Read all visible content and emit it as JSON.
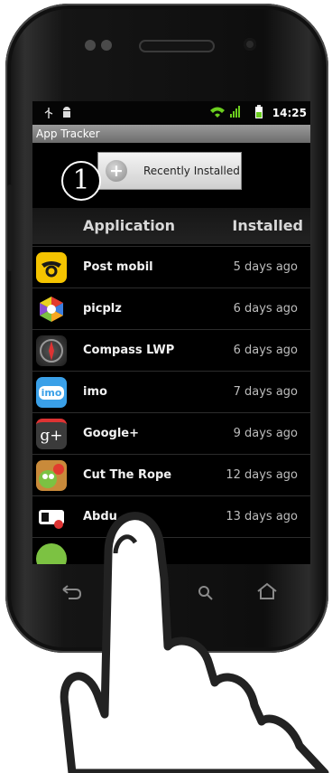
{
  "status": {
    "time": "14:25"
  },
  "app": {
    "title": "App Tracker"
  },
  "toolbar": {
    "filter_label": "Recently Installed",
    "step_number": "1"
  },
  "columns": {
    "application": "Application",
    "installed": "Installed"
  },
  "apps": [
    {
      "name": "Post mobil",
      "installed": "5 days ago",
      "icon": "post-horn-icon",
      "color": "#f5c400"
    },
    {
      "name": "picplz",
      "installed": "6 days ago",
      "icon": "picplz-icon",
      "color": "#3b7de0"
    },
    {
      "name": "Compass LWP",
      "installed": "6 days ago",
      "icon": "compass-icon",
      "color": "#3a3a3a"
    },
    {
      "name": "imo",
      "installed": "7 days ago",
      "icon": "imo-icon",
      "icon_text": "imo",
      "color": "#3aa0e8"
    },
    {
      "name": "Google+",
      "installed": "9 days ago",
      "icon": "google-plus-icon",
      "icon_text": "g+",
      "color": "#3b3b3b"
    },
    {
      "name": "Cut The Rope",
      "installed": "12 days ago",
      "icon": "cut-the-rope-icon",
      "color": "#c98a3a"
    },
    {
      "name": "Abdu",
      "installed": "13 days ago",
      "icon": "abdu-icon",
      "color": "#ffffff"
    }
  ],
  "colors": {
    "title_bar": "#8a8a8a",
    "list_bg": "#000000",
    "accent_green": "#6ccf1f"
  }
}
